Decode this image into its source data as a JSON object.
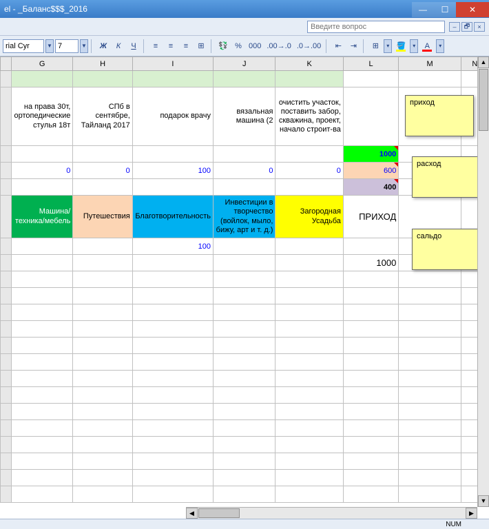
{
  "window": {
    "title": "el - _Баланс$$$_2016"
  },
  "ask": {
    "placeholder": "Введите вопрос"
  },
  "toolbar": {
    "font": "rial Cyr",
    "size": "7",
    "b": "Ж",
    "i": "К",
    "u": "Ч",
    "pct": "%",
    "thousands": "000",
    "dec_inc": "⁺₀₀",
    "dec_dec": "⁻₀₀"
  },
  "cols": [
    "G",
    "H",
    "I",
    "J",
    "K",
    "L",
    "M",
    "N"
  ],
  "row2": {
    "G": "на права 30т, ортопедические стулья 18т",
    "H": "СПб в сентябре, Тайланд 2017",
    "I": "подарок врачу",
    "J": "вязальная машина (2",
    "K": "очистить участок, поставить забор, скважина, проект, начало строит-ва"
  },
  "row3_L": "1000",
  "row4": {
    "G": "0",
    "H": "0",
    "I": "100",
    "J": "0",
    "K": "0",
    "L": "600"
  },
  "row5_L": "400",
  "row6": {
    "G": "Машина/техника/мебель",
    "H": "Путешествия",
    "I": "Благотворительность",
    "J": "Инвестиции в творчество (войлок, мыло, бижу, арт и т. д.)",
    "K": "Загородная Усадьба",
    "L": "ПРИХОД"
  },
  "row7_I": "100",
  "row8_L": "1000",
  "notes": {
    "n1": "приход",
    "n2": "расход",
    "n3": "сальдо"
  },
  "status": {
    "num": "NUM"
  }
}
